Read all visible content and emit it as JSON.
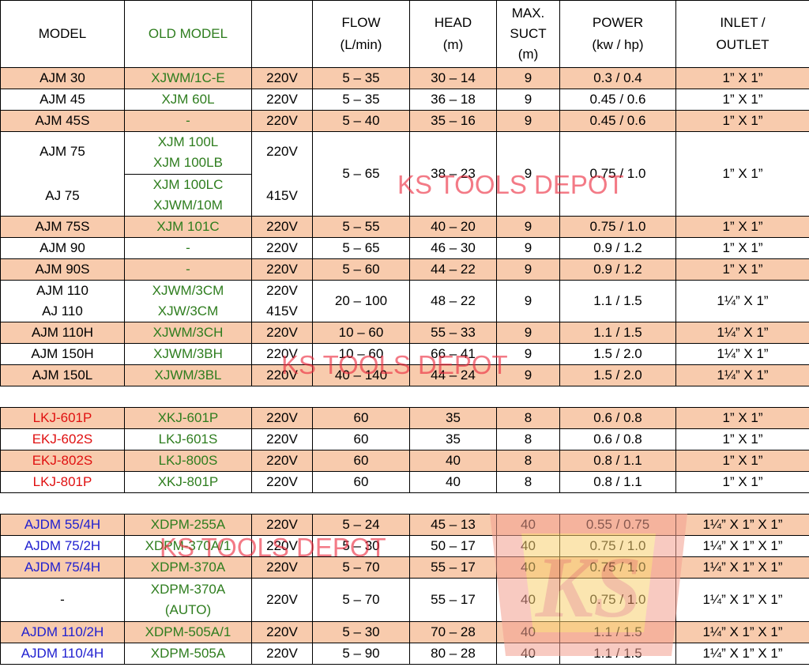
{
  "headers": {
    "model": "MODEL",
    "old_model": "OLD MODEL",
    "voltage": "",
    "flow": [
      "FLOW",
      "(L/min)"
    ],
    "head": [
      "HEAD",
      "(m)"
    ],
    "suct": [
      "MAX.",
      "SUCT",
      "(m)"
    ],
    "power": [
      "POWER",
      "(kw / hp)"
    ],
    "inlet": [
      "INLET /",
      "OUTLET"
    ]
  },
  "watermark": "KS TOOLS DEPOT",
  "logo_text": "KS",
  "colors": {
    "peach": "#f8cbad",
    "green": "#2e7d1e",
    "red": "#e01010",
    "blue": "#2020d0"
  },
  "rows": [
    {
      "model": "AJM 30",
      "old": "XJWM/1C-E",
      "volt": "220V",
      "flow": "5 – 35",
      "head": "30 – 14",
      "suct": "9",
      "power": "0.3 / 0.4",
      "inlet": "1” X 1”"
    },
    {
      "model": "AJM 45",
      "old": "XJM 60L",
      "volt": "220V",
      "flow": "5 – 35",
      "head": "36 – 18",
      "suct": "9",
      "power": "0.45 / 0.6",
      "inlet": "1” X 1”"
    },
    {
      "model": "AJM 45S",
      "old": "-",
      "volt": "220V",
      "flow": "5 – 40",
      "head": "35 – 16",
      "suct": "9",
      "power": "0.45 / 0.6",
      "inlet": "1” X 1”"
    },
    {
      "model": "AJM 75",
      "model2": "AJ 75",
      "old_a": "XJM 100L",
      "old_b": "XJM 100LB",
      "old_c": "XJM 100LC",
      "old_d": "XJWM/10M",
      "volt": "220V",
      "volt2": "415V",
      "flow": "5 – 65",
      "head": "38 – 23",
      "suct": "9",
      "power": "0.75 / 1.0",
      "inlet": "1” X 1”"
    },
    {
      "model": "AJM 75S",
      "old": "XJM 101C",
      "volt": "220V",
      "flow": "5 – 55",
      "head": "40 – 20",
      "suct": "9",
      "power": "0.75 / 1.0",
      "inlet": "1” X 1”"
    },
    {
      "model": "AJM 90",
      "old": "-",
      "volt": "220V",
      "flow": "5 – 65",
      "head": "46 – 30",
      "suct": "9",
      "power": "0.9 / 1.2",
      "inlet": "1” X 1”"
    },
    {
      "model": "AJM 90S",
      "old": "-",
      "volt": "220V",
      "flow": "5 – 60",
      "head": "44 – 22",
      "suct": "9",
      "power": "0.9 / 1.2",
      "inlet": "1” X 1”"
    },
    {
      "model": "AJM 110",
      "model2": "AJ 110",
      "old": "XJWM/3CM",
      "old2": "XJW/3CM",
      "volt": "220V",
      "volt2": "415V",
      "flow": "20 – 100",
      "head": "48 – 22",
      "suct": "9",
      "power": "1.1 / 1.5",
      "inlet": "1¼” X 1”"
    },
    {
      "model": "AJM 110H",
      "old": "XJWM/3CH",
      "volt": "220V",
      "flow": "10 – 60",
      "head": "55 – 33",
      "suct": "9",
      "power": "1.1 / 1.5",
      "inlet": "1¼” X 1”"
    },
    {
      "model": "AJM 150H",
      "old": "XJWM/3BH",
      "volt": "220V",
      "flow": "10 – 60",
      "head": "66 – 41",
      "suct": "9",
      "power": "1.5 / 2.0",
      "inlet": "1¼” X 1”"
    },
    {
      "model": "AJM 150L",
      "old": "XJWM/3BL",
      "volt": "220V",
      "flow": "40 – 140",
      "head": "44 – 24",
      "suct": "9",
      "power": "1.5 / 2.0",
      "inlet": "1¼” X 1”"
    },
    {
      "model": "LKJ-601P",
      "old": "XKJ-601P",
      "volt": "220V",
      "flow": "60",
      "head": "35",
      "suct": "8",
      "power": "0.6 / 0.8",
      "inlet": "1” X 1”"
    },
    {
      "model": "EKJ-602S",
      "old": "LKJ-601S",
      "volt": "220V",
      "flow": "60",
      "head": "35",
      "suct": "8",
      "power": "0.6 / 0.8",
      "inlet": "1” X 1”"
    },
    {
      "model": "EKJ-802S",
      "old": "LKJ-800S",
      "volt": "220V",
      "flow": "60",
      "head": "40",
      "suct": "8",
      "power": "0.8 / 1.1",
      "inlet": "1” X 1”"
    },
    {
      "model": "LKJ-801P",
      "old": "XKJ-801P",
      "volt": "220V",
      "flow": "60",
      "head": "40",
      "suct": "8",
      "power": "0.8 / 1.1",
      "inlet": "1” X 1”"
    },
    {
      "model": "AJDM 55/4H",
      "old": "XDPM-255A",
      "volt": "220V",
      "flow": "5 – 24",
      "head": "45 – 13",
      "suct": "40",
      "power": "0.55 / 0.75",
      "inlet": "1¼” X 1” X 1”"
    },
    {
      "model": "AJDM 75/2H",
      "old": "XDPM-370A/1",
      "volt": "220V",
      "flow": "5 – 30",
      "head": "50 – 17",
      "suct": "40",
      "power": "0.75 / 1.0",
      "inlet": "1¼” X 1” X 1”"
    },
    {
      "model": "AJDM 75/4H",
      "old": "XDPM-370A",
      "volt": "220V",
      "flow": "5 – 70",
      "head": "55 – 17",
      "suct": "40",
      "power": "0.75 / 1.0",
      "inlet": "1¼” X 1” X 1”"
    },
    {
      "model": "-",
      "old": "XDPM-370A",
      "old2": "(AUTO)",
      "volt": "220V",
      "flow": "5 – 70",
      "head": "55 – 17",
      "suct": "40",
      "power": "0.75 / 1.0",
      "inlet": "1¼” X 1” X 1”"
    },
    {
      "model": "AJDM 110/2H",
      "old": "XDPM-505A/1",
      "volt": "220V",
      "flow": "5 – 30",
      "head": "70 – 28",
      "suct": "40",
      "power": "1.1 / 1.5",
      "inlet": "1¼” X 1” X 1”"
    },
    {
      "model": "AJDM 110/4H",
      "old": "XDPM-505A",
      "volt": "220V",
      "flow": "5 – 90",
      "head": "80 – 28",
      "suct": "40",
      "power": "1.1 / 1.5",
      "inlet": "1¼” X 1” X 1”"
    }
  ]
}
